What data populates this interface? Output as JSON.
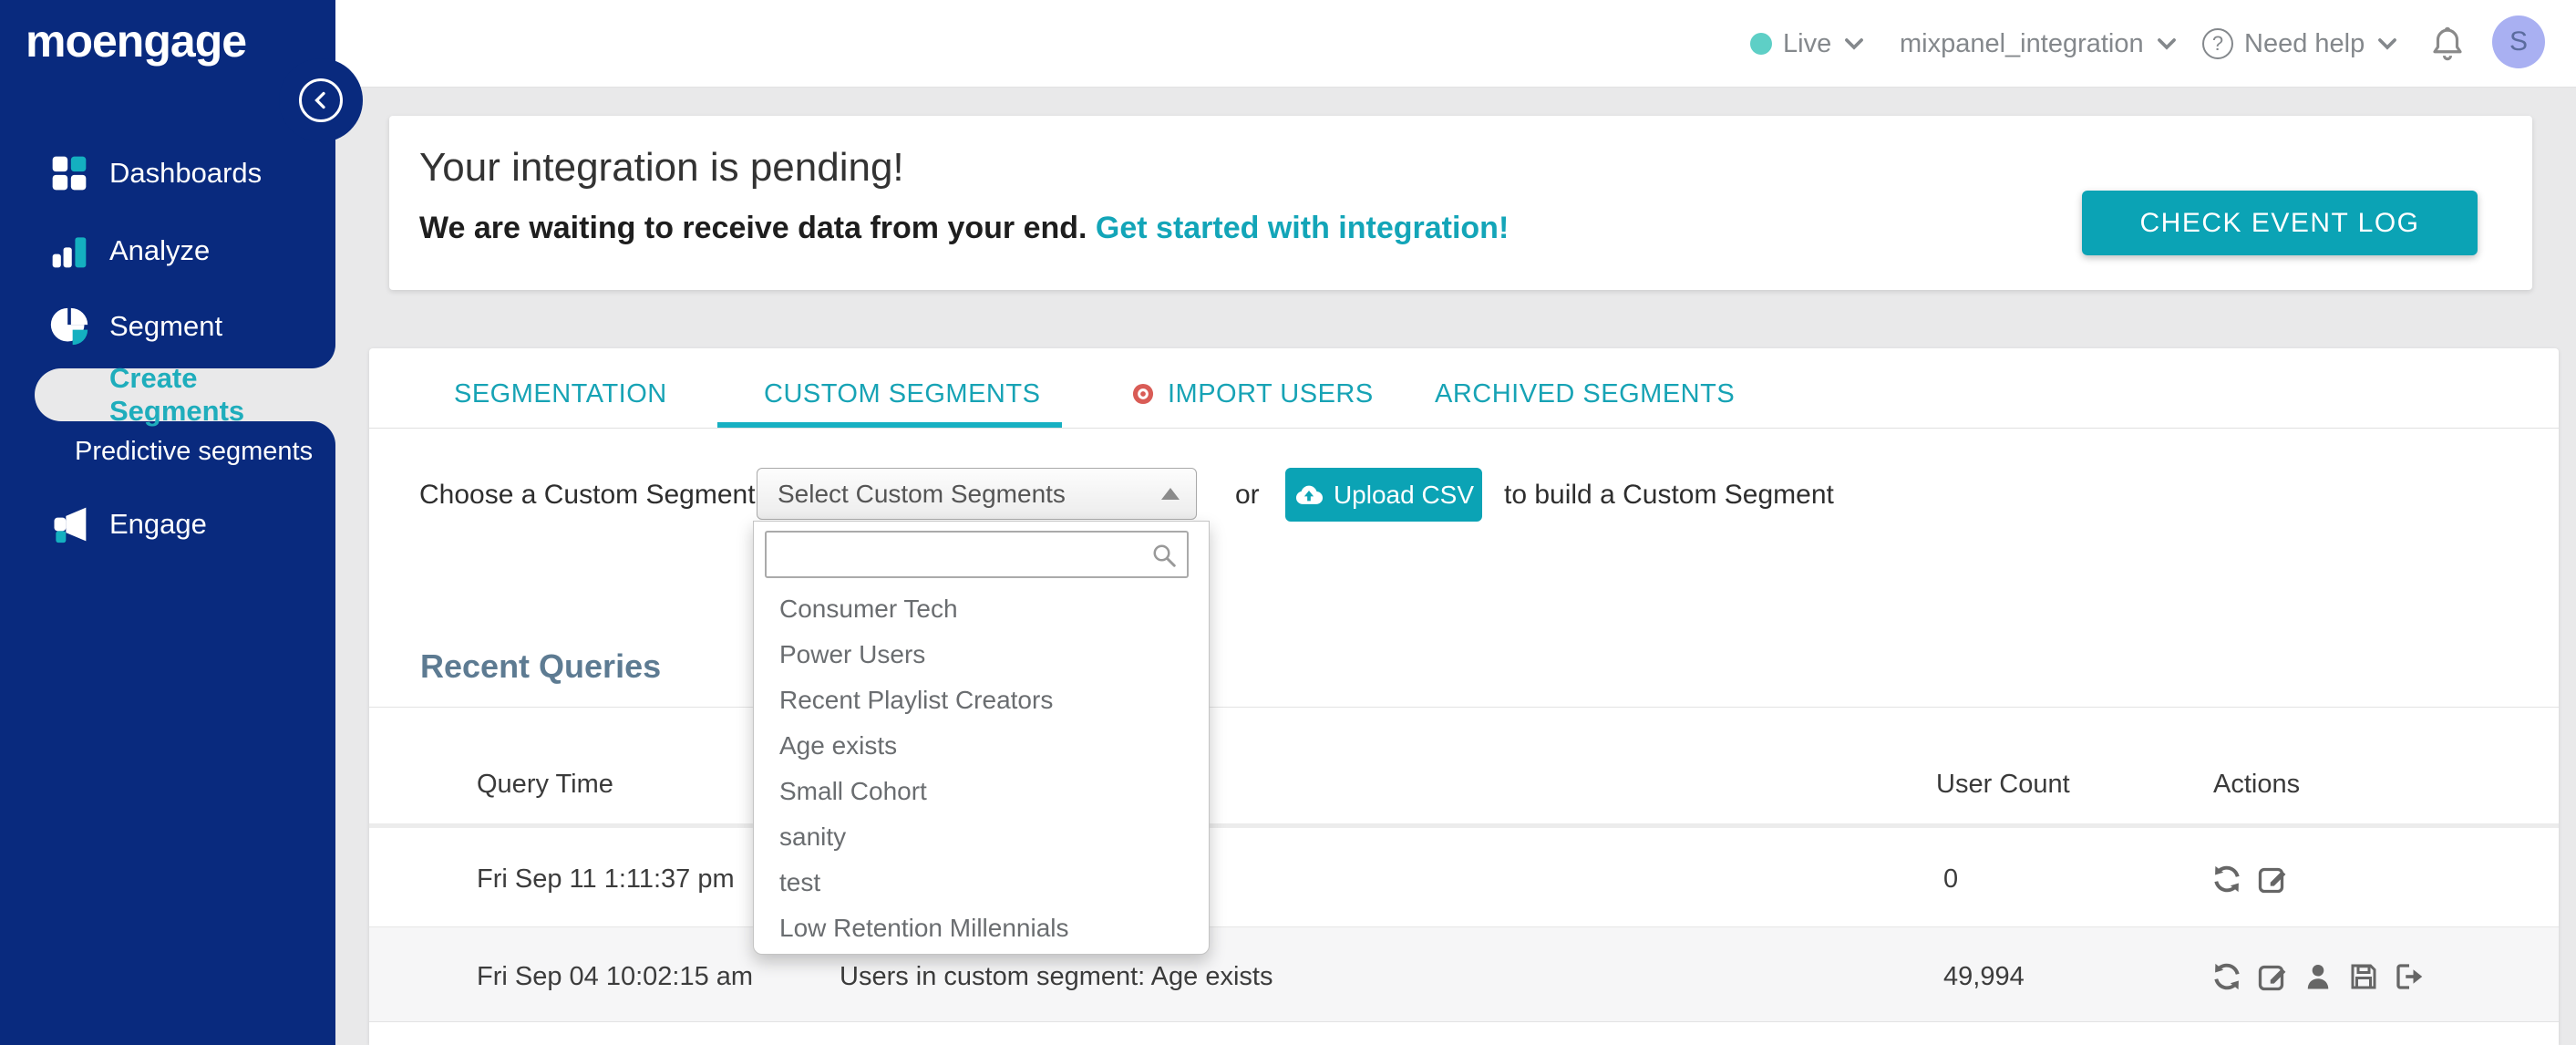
{
  "colors": {
    "sidebar_navy": "#092a7e",
    "accent_teal": "#0ba3b5",
    "teal_text": "#17a3b5",
    "mint_dot": "#5ecfc6",
    "slate_heading": "#5d7b92",
    "avatar_bg": "#a9b0f2",
    "import_dot_red": "#d95c56"
  },
  "sidebar": {
    "logo": "moengage",
    "items": [
      {
        "label": "Dashboards"
      },
      {
        "label": "Analyze"
      },
      {
        "label": "Segment"
      },
      {
        "label": "Engage"
      }
    ],
    "segment_children": [
      {
        "label": "Create Segments",
        "active": true
      },
      {
        "label": "Predictive segments",
        "active": false
      }
    ]
  },
  "topbar": {
    "env_label": "Live",
    "project_label": "mixpanel_integration",
    "help_label": "Need help",
    "help_icon": "?",
    "avatar_initial": "S"
  },
  "banner": {
    "title": "Your integration is pending!",
    "message": "We are waiting to receive data from your end.",
    "link_label": "Get started with integration!",
    "button_label": "CHECK EVENT LOG"
  },
  "tabs": {
    "items": [
      {
        "label": "SEGMENTATION",
        "active": false
      },
      {
        "label": "CUSTOM SEGMENTS",
        "active": true
      },
      {
        "label": "IMPORT USERS",
        "active": false,
        "icon": "record-dot-icon"
      },
      {
        "label": "ARCHIVED SEGMENTS",
        "active": false
      }
    ]
  },
  "picker": {
    "label": "Choose a Custom Segment:",
    "select_value": "Select Custom Segments",
    "or_label": "or",
    "upload_label": "Upload CSV",
    "suffix_label": "to build a Custom Segment",
    "search_placeholder": "",
    "options": [
      {
        "label": "Consumer Tech"
      },
      {
        "label": "Power Users"
      },
      {
        "label": "Recent Playlist Creators"
      },
      {
        "label": "Age exists"
      },
      {
        "label": "Small Cohort"
      },
      {
        "label": "sanity"
      },
      {
        "label": "test"
      },
      {
        "label": "Low Retention Millennials"
      }
    ]
  },
  "recent": {
    "title": "Recent Queries",
    "col_time": "Query Time",
    "col_count": "User Count",
    "col_actions": "Actions",
    "rows": [
      {
        "time": "Fri Sep 11 1:11:37 pm",
        "info": "",
        "count": "0",
        "actions": [
          "refresh",
          "edit"
        ]
      },
      {
        "time": "Fri Sep 04 10:02:15 am",
        "info": "Users in custom segment: Age exists",
        "count": "49,994",
        "actions": [
          "refresh",
          "edit",
          "user",
          "save",
          "export"
        ]
      }
    ]
  }
}
